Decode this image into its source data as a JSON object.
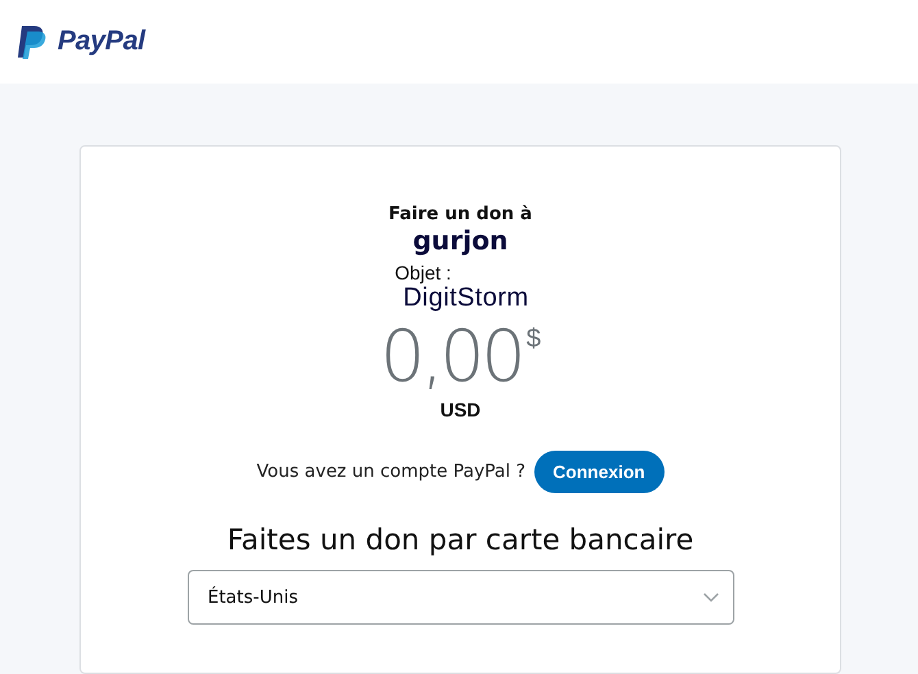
{
  "header": {
    "logo_text": "PayPal"
  },
  "donation": {
    "intro": "Faire un don à",
    "recipient": "gurjon",
    "subject_label": "Objet :",
    "subject": "DigitStorm",
    "amount": "0,00",
    "currency_symbol": "$",
    "currency": "USD"
  },
  "login": {
    "prompt": "Vous avez un compte PayPal ?",
    "button": "Connexion"
  },
  "card_section": {
    "heading": "Faites un don par carte bancaire",
    "country": {
      "value": "États-Unis"
    }
  }
}
